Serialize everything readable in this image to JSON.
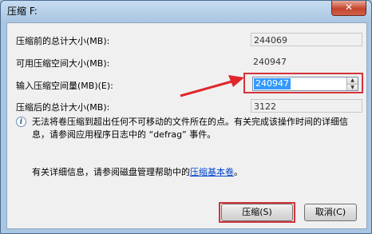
{
  "window": {
    "title": "压缩 F:",
    "close_glyph": "✕"
  },
  "fields": {
    "before_label": "压缩前的总计大小(MB):",
    "before_value": "244069",
    "available_label": "可用压缩空间大小(MB):",
    "available_value": "240947",
    "amount_label": "输入压缩空间量(MB)(E):",
    "amount_value": "240947",
    "after_label": "压缩后的总计大小(MB):",
    "after_value": "3122"
  },
  "info": {
    "icon": "info-icon",
    "text": "无法将卷压缩到超出任何不可移动的文件所在的点。有关完成该操作时间的详细信息，请参阅应用程序日志中的 “defrag” 事件。"
  },
  "detail": {
    "prefix": "有关详细信息，请参阅磁盘管理帮助中的",
    "link": "压缩基本卷",
    "suffix": "。"
  },
  "buttons": {
    "shrink": "压缩(S)",
    "cancel": "取消(C)"
  },
  "annotation": {
    "arrow_color": "#e0262b",
    "highlight_color": "#d2343a"
  }
}
